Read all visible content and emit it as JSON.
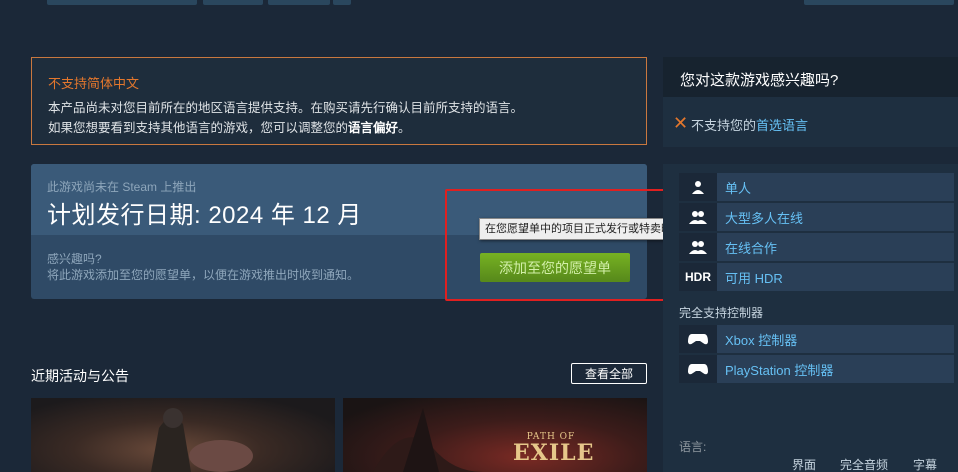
{
  "language_warning": {
    "title": "不支持简体中文",
    "line1": "本产品尚未对您目前所在的地区语言提供支持。在购买请先行确认目前所支持的语言。",
    "line2_prefix": "如果您想要看到支持其他语言的游戏，您可以调整您的",
    "line2_link": "语言偏好",
    "line2_suffix": "。"
  },
  "coming_soon": {
    "sub": "此游戏尚未在 Steam 上推出",
    "release": "计划发行日期: 2024 年 12 月",
    "interested": "感兴趣吗?",
    "desc": "将此游戏添加至您的愿望单，以便在游戏推出时收到通知。",
    "wishlist_button": "添加至您的愿望单",
    "tooltip": "在您愿望单中的项目正式发行或特卖时获取电子邮件通知"
  },
  "activity": {
    "title": "近期活动与公告",
    "view_all": "查看全部",
    "logo_small": "PATH OF",
    "logo_big": "EXILE"
  },
  "right": {
    "question": "您对这款游戏感兴趣吗?",
    "lang_unsupported": "不支持您的",
    "lang_pref_link": "首选语言",
    "features": [
      {
        "icon": "single-player-icon",
        "glyph": "👤",
        "label": "单人"
      },
      {
        "icon": "mmo-icon",
        "glyph": "👥",
        "label": "大型多人在线"
      },
      {
        "icon": "co-op-icon",
        "glyph": "👥",
        "label": "在线合作"
      },
      {
        "icon": "hdr-icon",
        "glyph": "HDR",
        "label": "可用 HDR"
      }
    ],
    "controller_header": "完全支持控制器",
    "controllers": [
      {
        "icon": "xbox-controller-icon",
        "glyph": "🎮",
        "label": "Xbox 控制器"
      },
      {
        "icon": "playstation-controller-icon",
        "glyph": "🎮",
        "label": "PlayStation 控制器"
      }
    ],
    "languages_title": "语言:",
    "language_columns": [
      "界面",
      "完全音频",
      "字幕"
    ]
  },
  "colors": {
    "background": "#1b2838",
    "warning_orange": "#e3772d",
    "link_blue": "#66c0f4",
    "wishlist_green": "#75b022",
    "highlight_red": "#e02020"
  }
}
